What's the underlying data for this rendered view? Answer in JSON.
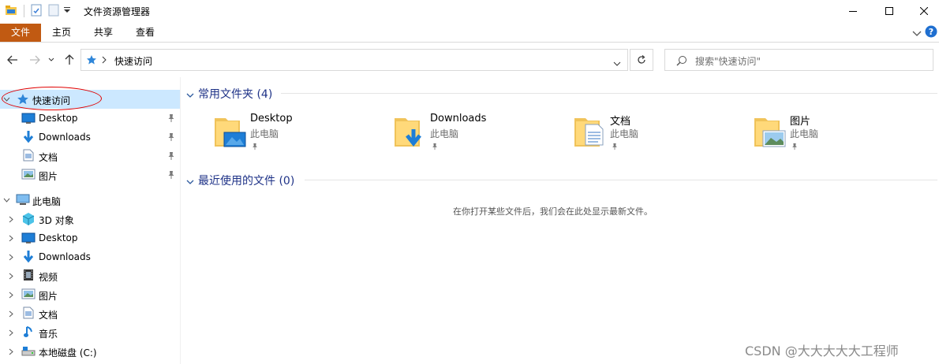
{
  "window": {
    "title": "文件资源管理器",
    "controls": {
      "minimize": "minimize-icon",
      "maximize": "maximize-icon",
      "close": "close-icon"
    }
  },
  "ribbon": {
    "tabs": [
      {
        "label": "文件",
        "active": true
      },
      {
        "label": "主页"
      },
      {
        "label": "共享"
      },
      {
        "label": "查看"
      }
    ]
  },
  "address": {
    "path": [
      "快速访问"
    ],
    "search_placeholder": "搜索\"快速访问\""
  },
  "nav": {
    "quick_access": {
      "label": "快速访问",
      "items": [
        {
          "label": "Desktop",
          "icon": "desktop-icon",
          "pinned": true
        },
        {
          "label": "Downloads",
          "icon": "downloads-icon",
          "pinned": true
        },
        {
          "label": "文档",
          "icon": "documents-icon",
          "pinned": true
        },
        {
          "label": "图片",
          "icon": "pictures-icon",
          "pinned": true
        }
      ]
    },
    "this_pc": {
      "label": "此电脑",
      "items": [
        {
          "label": "3D 对象",
          "icon": "3d-objects-icon"
        },
        {
          "label": "Desktop",
          "icon": "desktop-icon"
        },
        {
          "label": "Downloads",
          "icon": "downloads-icon"
        },
        {
          "label": "视频",
          "icon": "videos-icon"
        },
        {
          "label": "图片",
          "icon": "pictures-icon"
        },
        {
          "label": "文档",
          "icon": "documents-icon"
        },
        {
          "label": "音乐",
          "icon": "music-icon"
        },
        {
          "label": "本地磁盘 (C:)",
          "icon": "local-disk-icon"
        }
      ]
    }
  },
  "content": {
    "frequent": {
      "title": "常用文件夹 (4)",
      "folders": [
        {
          "name": "Desktop",
          "location": "此电脑",
          "icon": "desktop-folder-icon"
        },
        {
          "name": "Downloads",
          "location": "此电脑",
          "icon": "downloads-folder-icon"
        },
        {
          "name": "文档",
          "location": "此电脑",
          "icon": "documents-folder-icon"
        },
        {
          "name": "图片",
          "location": "此电脑",
          "icon": "pictures-folder-icon"
        }
      ]
    },
    "recent": {
      "title": "最近使用的文件 (0)",
      "empty_message": "在你打开某些文件后，我们会在此处显示最新文件。"
    }
  },
  "watermark": "CSDN @大大大大大工程师",
  "colors": {
    "file_tab": "#c15a12",
    "selected": "#cce8ff",
    "section_title": "#1e3287",
    "annotation": "#e00000"
  }
}
